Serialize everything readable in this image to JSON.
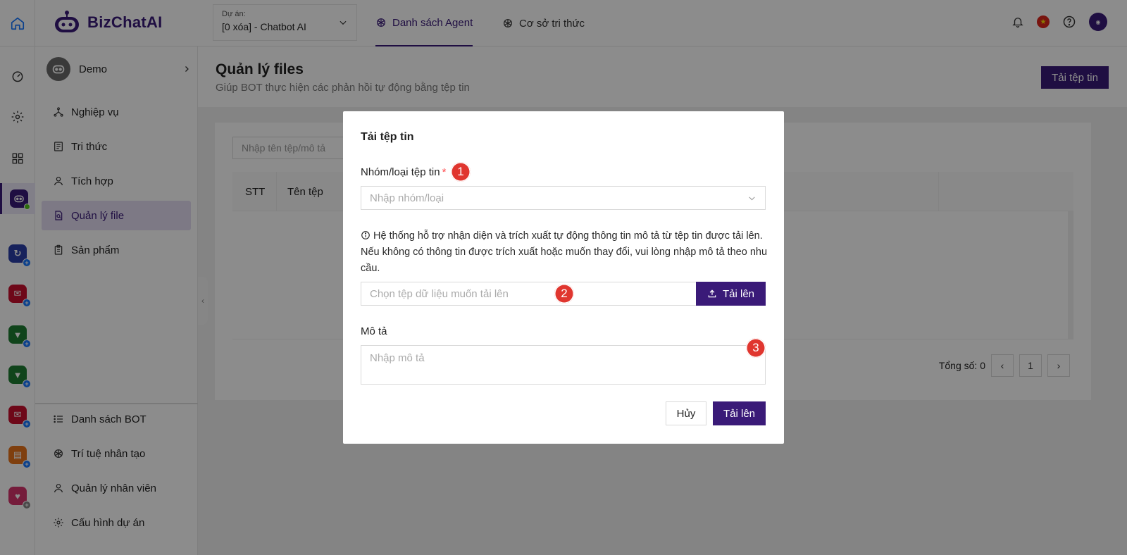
{
  "topbar": {
    "logo_text": "BizChatAI",
    "project_label": "Dự án:",
    "project_value": "[0 xóa] - Chatbot AI",
    "tabs": [
      {
        "label": "Danh sách Agent",
        "icon": "openai-icon",
        "active": true
      },
      {
        "label": "Cơ sở tri thức",
        "icon": "openai-icon",
        "active": false
      }
    ],
    "right_icons": [
      "bell-icon",
      "vietnam-flag-icon",
      "help-circle-icon",
      "user-avatar"
    ]
  },
  "rail": {
    "items": [
      "home-icon",
      "dashboard-icon",
      "settings-icon",
      "apps-grid-icon",
      "chatbot-app",
      "bizfly-connect-app",
      "email-app",
      "chat-app-1",
      "chat-app-2",
      "email-app-2",
      "clipboard-app",
      "heart-app"
    ]
  },
  "sidebar": {
    "bot_name": "Demo",
    "items": [
      {
        "label": "Nghiệp vụ",
        "icon": "workflow-icon"
      },
      {
        "label": "Tri thức",
        "icon": "book-icon"
      },
      {
        "label": "Tích hợp",
        "icon": "user-icon"
      },
      {
        "label": "Quản lý file",
        "icon": "file-search-icon",
        "active": true
      },
      {
        "label": "Sản phẩm",
        "icon": "clipboard-icon"
      }
    ],
    "bottom_items": [
      {
        "label": "Danh sách BOT",
        "icon": "list-icon"
      },
      {
        "label": "Trí tuệ nhân tạo",
        "icon": "openai-icon"
      },
      {
        "label": "Quản lý nhân viên",
        "icon": "user-icon"
      },
      {
        "label": "Cấu hình dự án",
        "icon": "gear-icon"
      }
    ]
  },
  "page": {
    "title": "Quản lý files",
    "subtitle": "Giúp BOT thực hiện các phản hồi tự động bằng tệp tin",
    "upload_button": "Tải tệp tin",
    "search_placeholder": "Nhập tên tệp/mô tả",
    "columns": [
      "STT",
      "Tên tệp"
    ],
    "total_label": "Tổng số: 0",
    "current_page": "1"
  },
  "modal": {
    "title": "Tải tệp tin",
    "group_label": "Nhóm/loại tệp tin",
    "required_mark": "*",
    "group_placeholder": "Nhập nhóm/loại",
    "info_text": "Hệ thống hỗ trợ nhận diện và trích xuất tự động thông tin mô tả từ tệp tin được tải lên. Nếu không có thông tin được trích xuất hoặc muốn thay đổi, vui lòng nhập mô tả theo nhu cầu.",
    "file_placeholder": "Chọn tệp dữ liệu muốn tải lên",
    "file_button": "Tải lên",
    "desc_label": "Mô tả",
    "desc_placeholder": "Nhập mô tả",
    "cancel_button": "Hủy",
    "submit_button": "Tải lên",
    "markers": [
      "1",
      "2",
      "3"
    ]
  },
  "colors": {
    "brand": "#3a1a78",
    "marker": "#e0362f",
    "required": "#ff4d4f"
  }
}
